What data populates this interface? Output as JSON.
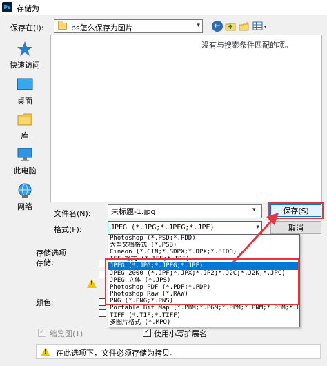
{
  "window": {
    "title": "存储为",
    "app_icon_text": "Ps"
  },
  "save_in": {
    "label": "保存在(I):",
    "value": "ps怎么保存为图片"
  },
  "toolbar_icons": [
    "back-icon",
    "up-folder-icon",
    "new-folder-icon",
    "view-menu-icon"
  ],
  "places": [
    {
      "label": "快速访问",
      "icon": "star-icon"
    },
    {
      "label": "桌面",
      "icon": "desktop-icon"
    },
    {
      "label": "库",
      "icon": "library-icon"
    },
    {
      "label": "此电脑",
      "icon": "computer-icon"
    },
    {
      "label": "网络",
      "icon": "network-icon"
    }
  ],
  "file_list": {
    "empty_message": "没有与搜索条件匹配的项。"
  },
  "filename": {
    "label": "文件名(N):",
    "value": "未标题-1.jpg"
  },
  "format": {
    "label": "格式(F):",
    "value": "JPEG (*.JPG;*.JPEG;*.JPE)",
    "options": [
      "Photoshop (*.PSD;*.PDD)",
      "大型文档格式 (*.PSB)",
      "Cineon (*.CIN;*.SDPX;*.DPX;*.FIDO)",
      "IFF 格式 (*.IFF;*.TDI)",
      "JPEG (*.JPG;*.JPEG;*.JPE)",
      "JPEG 2000 (*.JPF;*.JPX;*.JP2;*.J2C;*.J2K;*.JPC)",
      "JPEG 立体 (*.JPS)",
      "Photoshop PDF (*.PDF;*.PDP)",
      "Photoshop Raw (*.RAW)",
      "PNG (*.PNG;*.PNS)",
      "Portable Bit Map (*.PBM;*.PGM;*.PPM;*.PNM;*.PFM;*.PAM)",
      "TIFF (*.TIF;*.TIFF)",
      "多图片格式 (*.MPO)"
    ],
    "selected_index": 4
  },
  "buttons": {
    "save": "保存(S)",
    "cancel": "取消"
  },
  "options": {
    "title": "存储选项",
    "save_label": "存储:",
    "color_label": "颜色:",
    "thumbnail": {
      "label": "缩览图(T)",
      "checked": true,
      "disabled": true
    },
    "lowercase_ext": {
      "label": "使用小写扩展名",
      "checked": true
    }
  },
  "notice": "在此选项下，文件必须存储为拷贝。",
  "colors": {
    "highlight": "#e8343c",
    "selection": "#0078d7",
    "button_focus_bg": "#e5f1fb"
  }
}
